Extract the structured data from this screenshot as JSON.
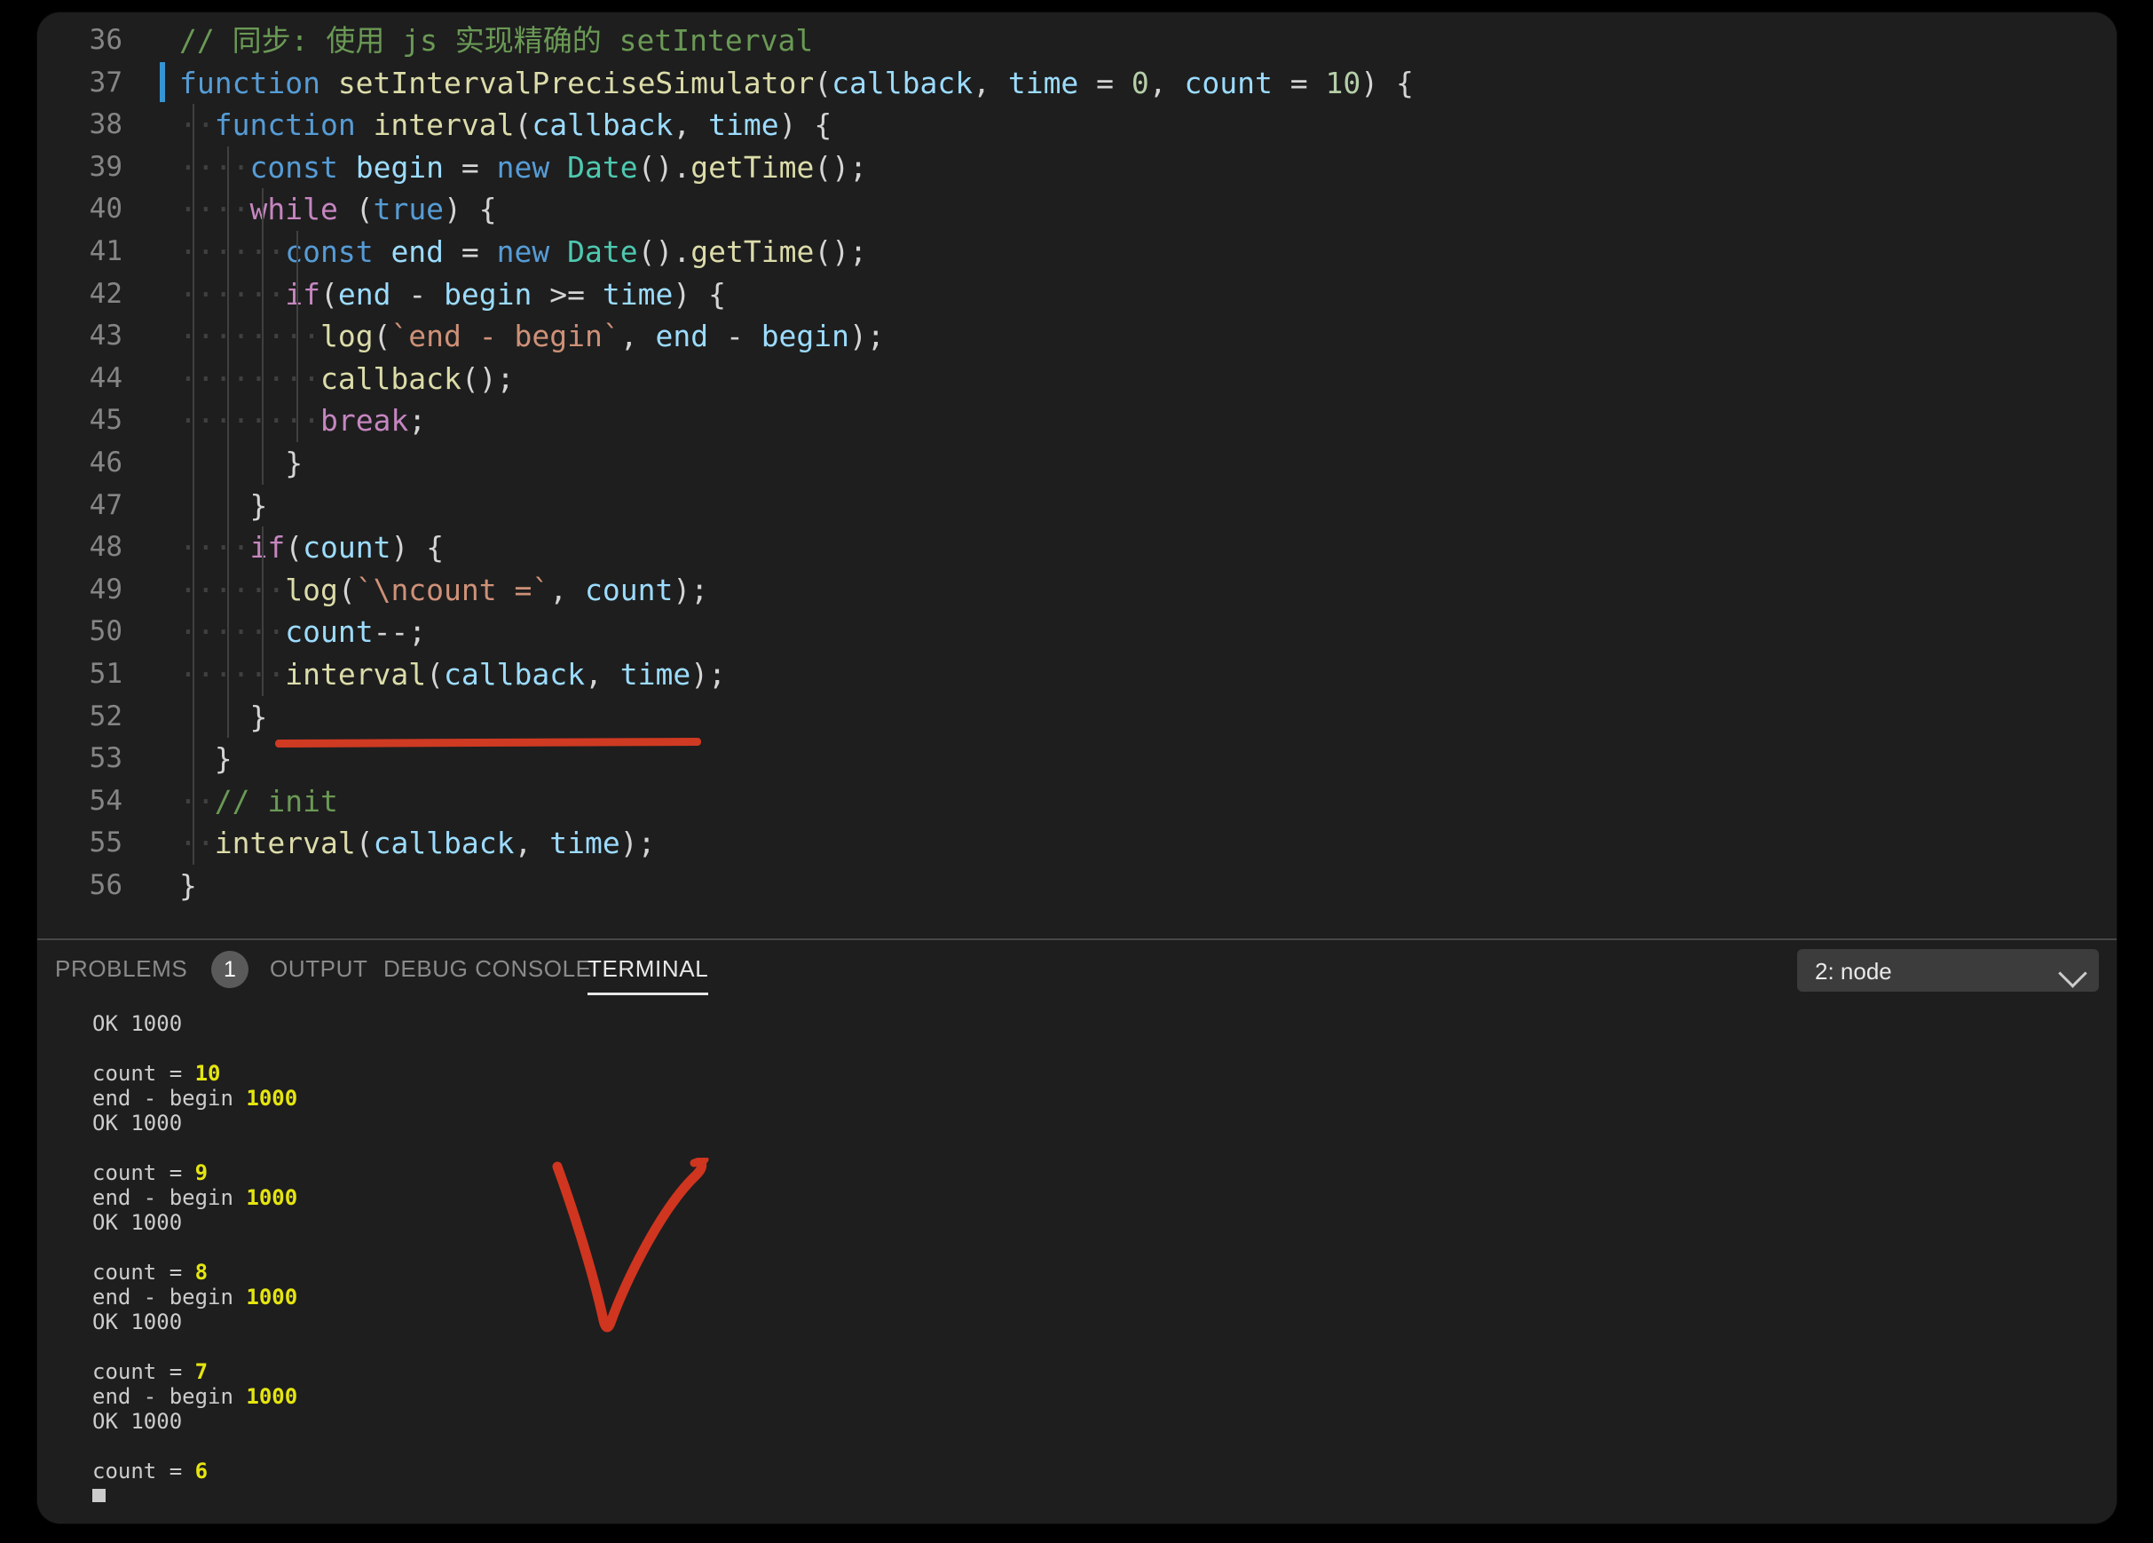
{
  "editor": {
    "first_line_number": 36,
    "cursor_line": 37,
    "lines": [
      {
        "n": 36,
        "tokens": [
          {
            "t": "// 同步: 使用 js 实现精确的 setInterval",
            "c": "t-comment"
          }
        ]
      },
      {
        "n": 37,
        "tokens": [
          {
            "t": "function ",
            "c": "t-kw"
          },
          {
            "t": "setIntervalPreciseSimulator",
            "c": "t-fn"
          },
          {
            "t": "(",
            "c": "t-plain"
          },
          {
            "t": "callback",
            "c": "t-var"
          },
          {
            "t": ", ",
            "c": "t-plain"
          },
          {
            "t": "time",
            "c": "t-var"
          },
          {
            "t": " = ",
            "c": "t-plain"
          },
          {
            "t": "0",
            "c": "t-num"
          },
          {
            "t": ", ",
            "c": "t-plain"
          },
          {
            "t": "count",
            "c": "t-var"
          },
          {
            "t": " = ",
            "c": "t-plain"
          },
          {
            "t": "10",
            "c": "t-num"
          },
          {
            "t": ") {",
            "c": "t-plain"
          }
        ]
      },
      {
        "n": 38,
        "tokens": [
          {
            "t": "  ",
            "c": "t-plain"
          },
          {
            "t": "function ",
            "c": "t-kw"
          },
          {
            "t": "interval",
            "c": "t-fn"
          },
          {
            "t": "(",
            "c": "t-plain"
          },
          {
            "t": "callback",
            "c": "t-var"
          },
          {
            "t": ", ",
            "c": "t-plain"
          },
          {
            "t": "time",
            "c": "t-var"
          },
          {
            "t": ") {",
            "c": "t-plain"
          }
        ]
      },
      {
        "n": 39,
        "tokens": [
          {
            "t": "    ",
            "c": "t-plain"
          },
          {
            "t": "const ",
            "c": "t-kw"
          },
          {
            "t": "begin",
            "c": "t-var"
          },
          {
            "t": " = ",
            "c": "t-plain"
          },
          {
            "t": "new ",
            "c": "t-kw"
          },
          {
            "t": "Date",
            "c": "t-type"
          },
          {
            "t": "()",
            "c": "t-plain"
          },
          {
            "t": ".",
            "c": "t-plain"
          },
          {
            "t": "getTime",
            "c": "t-fn"
          },
          {
            "t": "();",
            "c": "t-plain"
          }
        ]
      },
      {
        "n": 40,
        "tokens": [
          {
            "t": "    ",
            "c": "t-plain"
          },
          {
            "t": "while",
            "c": "t-ctrl"
          },
          {
            "t": " (",
            "c": "t-plain"
          },
          {
            "t": "true",
            "c": "t-kw"
          },
          {
            "t": ") {",
            "c": "t-plain"
          }
        ]
      },
      {
        "n": 41,
        "tokens": [
          {
            "t": "      ",
            "c": "t-plain"
          },
          {
            "t": "const ",
            "c": "t-kw"
          },
          {
            "t": "end",
            "c": "t-var"
          },
          {
            "t": " = ",
            "c": "t-plain"
          },
          {
            "t": "new ",
            "c": "t-kw"
          },
          {
            "t": "Date",
            "c": "t-type"
          },
          {
            "t": "()",
            "c": "t-plain"
          },
          {
            "t": ".",
            "c": "t-plain"
          },
          {
            "t": "getTime",
            "c": "t-fn"
          },
          {
            "t": "();",
            "c": "t-plain"
          }
        ]
      },
      {
        "n": 42,
        "tokens": [
          {
            "t": "      ",
            "c": "t-plain"
          },
          {
            "t": "if",
            "c": "t-ctrl"
          },
          {
            "t": "(",
            "c": "t-plain"
          },
          {
            "t": "end",
            "c": "t-var"
          },
          {
            "t": " - ",
            "c": "t-plain"
          },
          {
            "t": "begin",
            "c": "t-var"
          },
          {
            "t": " >= ",
            "c": "t-plain"
          },
          {
            "t": "time",
            "c": "t-var"
          },
          {
            "t": ") {",
            "c": "t-plain"
          }
        ]
      },
      {
        "n": 43,
        "tokens": [
          {
            "t": "        ",
            "c": "t-plain"
          },
          {
            "t": "log",
            "c": "t-fn"
          },
          {
            "t": "(",
            "c": "t-plain"
          },
          {
            "t": "`end - begin`",
            "c": "t-str"
          },
          {
            "t": ", ",
            "c": "t-plain"
          },
          {
            "t": "end",
            "c": "t-var"
          },
          {
            "t": " - ",
            "c": "t-plain"
          },
          {
            "t": "begin",
            "c": "t-var"
          },
          {
            "t": ");",
            "c": "t-plain"
          }
        ]
      },
      {
        "n": 44,
        "tokens": [
          {
            "t": "        ",
            "c": "t-plain"
          },
          {
            "t": "callback",
            "c": "t-fn"
          },
          {
            "t": "();",
            "c": "t-plain"
          }
        ]
      },
      {
        "n": 45,
        "tokens": [
          {
            "t": "        ",
            "c": "t-plain"
          },
          {
            "t": "break",
            "c": "t-ctrl"
          },
          {
            "t": ";",
            "c": "t-plain"
          }
        ]
      },
      {
        "n": 46,
        "tokens": [
          {
            "t": "      }",
            "c": "t-plain"
          }
        ]
      },
      {
        "n": 47,
        "tokens": [
          {
            "t": "    }",
            "c": "t-plain"
          }
        ]
      },
      {
        "n": 48,
        "tokens": [
          {
            "t": "    ",
            "c": "t-plain"
          },
          {
            "t": "if",
            "c": "t-ctrl"
          },
          {
            "t": "(",
            "c": "t-plain"
          },
          {
            "t": "count",
            "c": "t-var"
          },
          {
            "t": ") {",
            "c": "t-plain"
          }
        ]
      },
      {
        "n": 49,
        "tokens": [
          {
            "t": "      ",
            "c": "t-plain"
          },
          {
            "t": "log",
            "c": "t-fn"
          },
          {
            "t": "(",
            "c": "t-plain"
          },
          {
            "t": "`\\ncount =`",
            "c": "t-str"
          },
          {
            "t": ", ",
            "c": "t-plain"
          },
          {
            "t": "count",
            "c": "t-var"
          },
          {
            "t": ");",
            "c": "t-plain"
          }
        ]
      },
      {
        "n": 50,
        "tokens": [
          {
            "t": "      ",
            "c": "t-plain"
          },
          {
            "t": "count",
            "c": "t-var"
          },
          {
            "t": "--;",
            "c": "t-plain"
          }
        ]
      },
      {
        "n": 51,
        "tokens": [
          {
            "t": "      ",
            "c": "t-plain"
          },
          {
            "t": "interval",
            "c": "t-fn"
          },
          {
            "t": "(",
            "c": "t-plain"
          },
          {
            "t": "callback",
            "c": "t-var"
          },
          {
            "t": ", ",
            "c": "t-plain"
          },
          {
            "t": "time",
            "c": "t-var"
          },
          {
            "t": ");",
            "c": "t-plain"
          }
        ]
      },
      {
        "n": 52,
        "tokens": [
          {
            "t": "    }",
            "c": "t-plain"
          }
        ]
      },
      {
        "n": 53,
        "tokens": [
          {
            "t": "  }",
            "c": "t-plain"
          }
        ]
      },
      {
        "n": 54,
        "tokens": [
          {
            "t": "  ",
            "c": "t-plain"
          },
          {
            "t": "// init",
            "c": "t-comment"
          }
        ]
      },
      {
        "n": 55,
        "tokens": [
          {
            "t": "  ",
            "c": "t-plain"
          },
          {
            "t": "interval",
            "c": "t-fn"
          },
          {
            "t": "(",
            "c": "t-plain"
          },
          {
            "t": "callback",
            "c": "t-var"
          },
          {
            "t": ", ",
            "c": "t-plain"
          },
          {
            "t": "time",
            "c": "t-var"
          },
          {
            "t": ");",
            "c": "t-plain"
          }
        ]
      },
      {
        "n": 56,
        "tokens": [
          {
            "t": "}",
            "c": "t-plain"
          }
        ]
      }
    ]
  },
  "panel": {
    "tabs": [
      {
        "label": "PROBLEMS",
        "active": false,
        "badge": "1"
      },
      {
        "label": "OUTPUT",
        "active": false
      },
      {
        "label": "DEBUG CONSOLE",
        "active": false
      },
      {
        "label": "TERMINAL",
        "active": true
      }
    ],
    "terminal_selector": {
      "value": "2: node",
      "chevron_icon": "chevron-down-icon"
    }
  },
  "terminal": {
    "lines": [
      {
        "text": "OK 1000",
        "num": ""
      },
      {
        "text": "",
        "num": ""
      },
      {
        "text": "count = ",
        "num": "10"
      },
      {
        "text": "end - begin ",
        "num": "1000"
      },
      {
        "text": "OK 1000",
        "num": ""
      },
      {
        "text": "",
        "num": ""
      },
      {
        "text": "count = ",
        "num": "9"
      },
      {
        "text": "end - begin ",
        "num": "1000"
      },
      {
        "text": "OK 1000",
        "num": ""
      },
      {
        "text": "",
        "num": ""
      },
      {
        "text": "count = ",
        "num": "8"
      },
      {
        "text": "end - begin ",
        "num": "1000"
      },
      {
        "text": "OK 1000",
        "num": ""
      },
      {
        "text": "",
        "num": ""
      },
      {
        "text": "count = ",
        "num": "7"
      },
      {
        "text": "end - begin ",
        "num": "1000"
      },
      {
        "text": "OK 1000",
        "num": ""
      },
      {
        "text": "",
        "num": ""
      },
      {
        "text": "count = ",
        "num": "6"
      }
    ]
  },
  "annotations": {
    "underline_color": "#cf3a22",
    "check_color": "#d0351f"
  }
}
